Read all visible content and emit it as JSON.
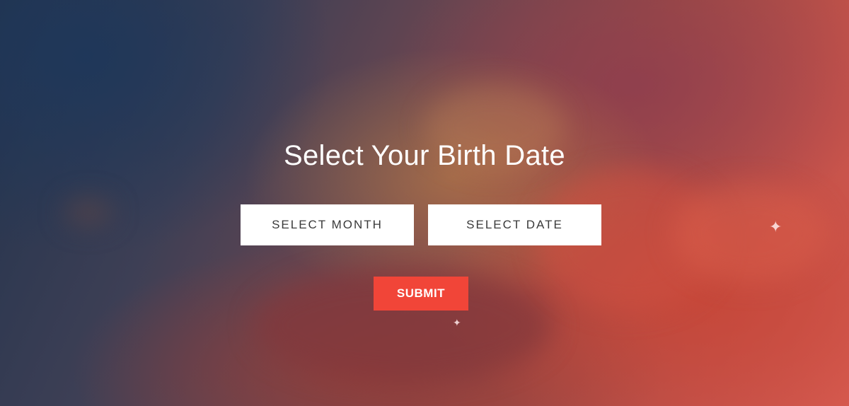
{
  "hero": {
    "title": "Select Your Birth Date"
  },
  "form": {
    "month_select_label": "SELECT MONTH",
    "date_select_label": "SELECT DATE",
    "submit_label": "SUBMIT"
  },
  "colors": {
    "submit_background": "#f14538",
    "select_background": "#ffffff",
    "title_text": "#ffffff"
  },
  "icons": {
    "sparkle": "✦"
  }
}
